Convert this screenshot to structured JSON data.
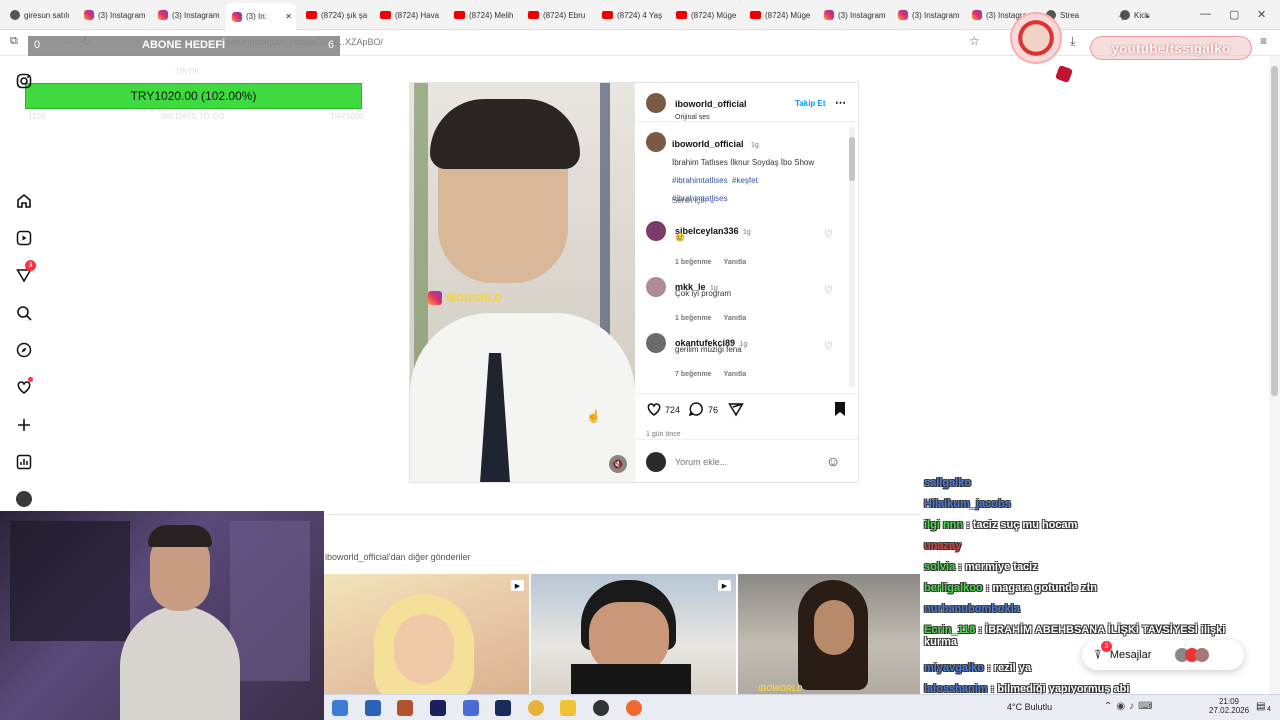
{
  "browser": {
    "tabs": [
      {
        "label": "giresun satılı",
        "icon": "bag-icon"
      },
      {
        "label": "(3) Instagram",
        "icon": "instagram-icon"
      },
      {
        "label": "(3) Instagram",
        "icon": "instagram-icon"
      },
      {
        "label": "(3) In:",
        "icon": "instagram-icon",
        "active": true
      },
      {
        "label": "(8724) şık şa",
        "icon": "youtube-icon"
      },
      {
        "label": "(8724) Hava",
        "icon": "youtube-icon"
      },
      {
        "label": "(8724) Melih",
        "icon": "youtube-icon"
      },
      {
        "label": "(8724) Ebru",
        "icon": "youtube-icon"
      },
      {
        "label": "(8724) 4 Yaş",
        "icon": "youtube-icon"
      },
      {
        "label": "(8724) Müge",
        "icon": "youtube-icon"
      },
      {
        "label": "(8724) Müge",
        "icon": "youtube-icon"
      },
      {
        "label": "(3) Instagram",
        "icon": "instagram-icon"
      },
      {
        "label": "(3) Instagram",
        "icon": "instagram-icon"
      },
      {
        "label": "(3) Instagra",
        "icon": "instagram-icon"
      },
      {
        "label": "Strea",
        "icon": "stream-icon"
      },
      {
        "label": "Kick",
        "icon": "kick-icon"
      }
    ],
    "url": "www.instagram.com/p/DVO…XZApBO/"
  },
  "goal_widget": {
    "left_value": "0",
    "title": "ABONE HEDEFİ",
    "right_value": "6",
    "amount": "TRY1020.00 (102.00%)",
    "progress_fraction": 1.02,
    "under_labels": [
      "TIKTIK",
      "1120",
      "365 DAYS TO GO",
      "TRY1000"
    ]
  },
  "post": {
    "author": "iboworld_official",
    "audio": "Orijinal ses",
    "follow": "Takip Et",
    "watermark": "IBOWORLD",
    "caption_user": "iboworld_official",
    "caption_time": "1g",
    "caption_text": "İbrahim Tatlıses İlknur Soydaş İbo Show",
    "hashtags": [
      "#ibrahimtatlises",
      "#keşfet",
      "#ibrahimtatlises"
    ],
    "sort": "Senin için",
    "comments": [
      {
        "user": "sibelceylan336",
        "time": "1g",
        "text": "😢",
        "likes": "1 beğenme",
        "reply": "Yanıtla"
      },
      {
        "user": "mkk_le",
        "time": "1g",
        "text": "Çok iyi program",
        "likes": "1 beğenme",
        "reply": "Yanıtla"
      },
      {
        "user": "okantufekci89",
        "time": "1g",
        "text": "gerilim müziği fena",
        "likes": "7 beğenme",
        "reply": "Yanıtla"
      }
    ],
    "like_count": "724",
    "comment_count": "76",
    "posted": "1 gün önce",
    "comment_placeholder": "Yorum ekle..."
  },
  "others_title": "iboworld_official'dan diğer gönderiler",
  "chat": [
    {
      "user": "sallgalko",
      "text": "",
      "color": "#4a7ad8"
    },
    {
      "user": "Hilalkum_jacobs",
      "text": "",
      "color": "#4a7ad8"
    },
    {
      "user": "ilgi nnn",
      "text": "taciz suç mu hocam",
      "color": "#4ad84a"
    },
    {
      "user": "unazay",
      "text": "",
      "color": "#e04040"
    },
    {
      "user": "solvia",
      "text": "mermiye taciz",
      "color": "#4ad84a"
    },
    {
      "user": "berligalkoo",
      "text": "magara gotunde ztn",
      "color": "#4ad84a"
    },
    {
      "user": "nurbanubombokla",
      "text": "",
      "color": "#4a7ad8"
    },
    {
      "user": "Ecrin_118",
      "text": "İBRAHİM ABEHBSANA İLİŞKİ TAVSİYESİ ilişki kurma",
      "color": "#4ad84a"
    },
    {
      "user": "miyavgalko",
      "text": "rezil ya",
      "color": "#4a7ad8"
    },
    {
      "user": "lalosshanim",
      "text": "bilmediği yapıyormuş abi",
      "color": "#4a7ad8"
    }
  ],
  "messages": {
    "label": "Mesajlar",
    "badge": "3"
  },
  "youtube_overlay": "youtube/tssigalko",
  "taskbar": {
    "weather": "4°C  Bulutlu",
    "time": "21:09",
    "date": "27.02.2026",
    "notifications": "4"
  },
  "rail_badge": "3"
}
